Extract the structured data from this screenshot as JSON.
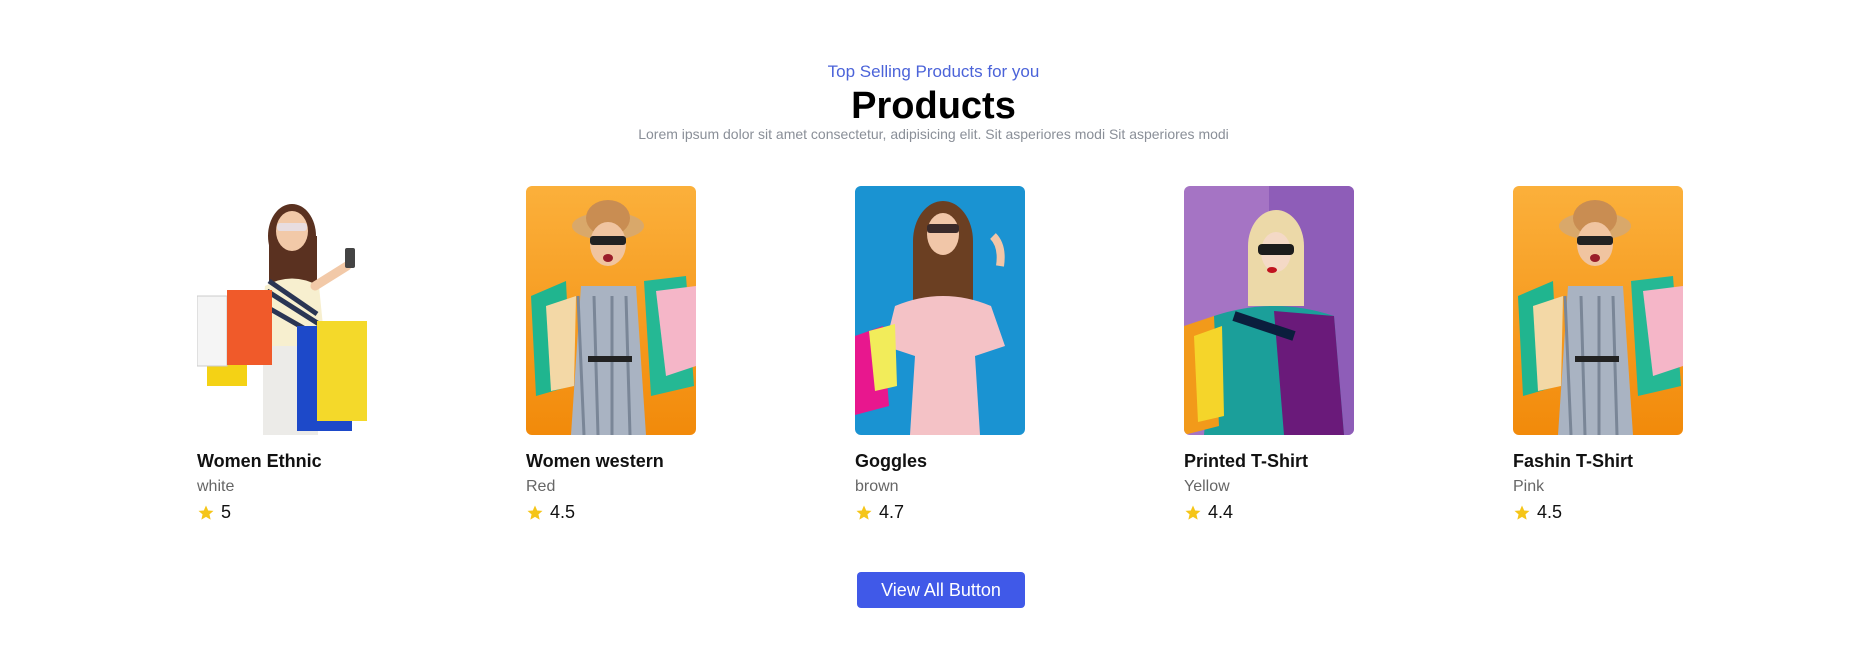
{
  "section": {
    "eyebrow": "Top Selling Products for you",
    "title": "Products",
    "subtitle": "Lorem ipsum dolor sit amet consectetur, adipisicing elit. Sit asperiores modi Sit asperiores modi"
  },
  "products": [
    {
      "name": "Women Ethnic",
      "color": "white",
      "rating": "5",
      "image_bg": "#ffffff"
    },
    {
      "name": "Women western",
      "color": "Red",
      "rating": "4.5",
      "image_bg": "#f7a21a"
    },
    {
      "name": "Goggles",
      "color": "brown",
      "rating": "4.7",
      "image_bg": "#1a93d2"
    },
    {
      "name": "Printed T-Shirt",
      "color": "Yellow",
      "rating": "4.4",
      "image_bg": "#a574c4"
    },
    {
      "name": "Fashin T-Shirt",
      "color": "Pink",
      "rating": "4.5",
      "image_bg": "#f7a21a"
    }
  ],
  "actions": {
    "view_all_label": "View All Button"
  },
  "colors": {
    "accent": "#4059e8",
    "eyebrow": "#4b63d9",
    "star": "#f5c518"
  },
  "icons": {
    "rating": "star-icon"
  }
}
